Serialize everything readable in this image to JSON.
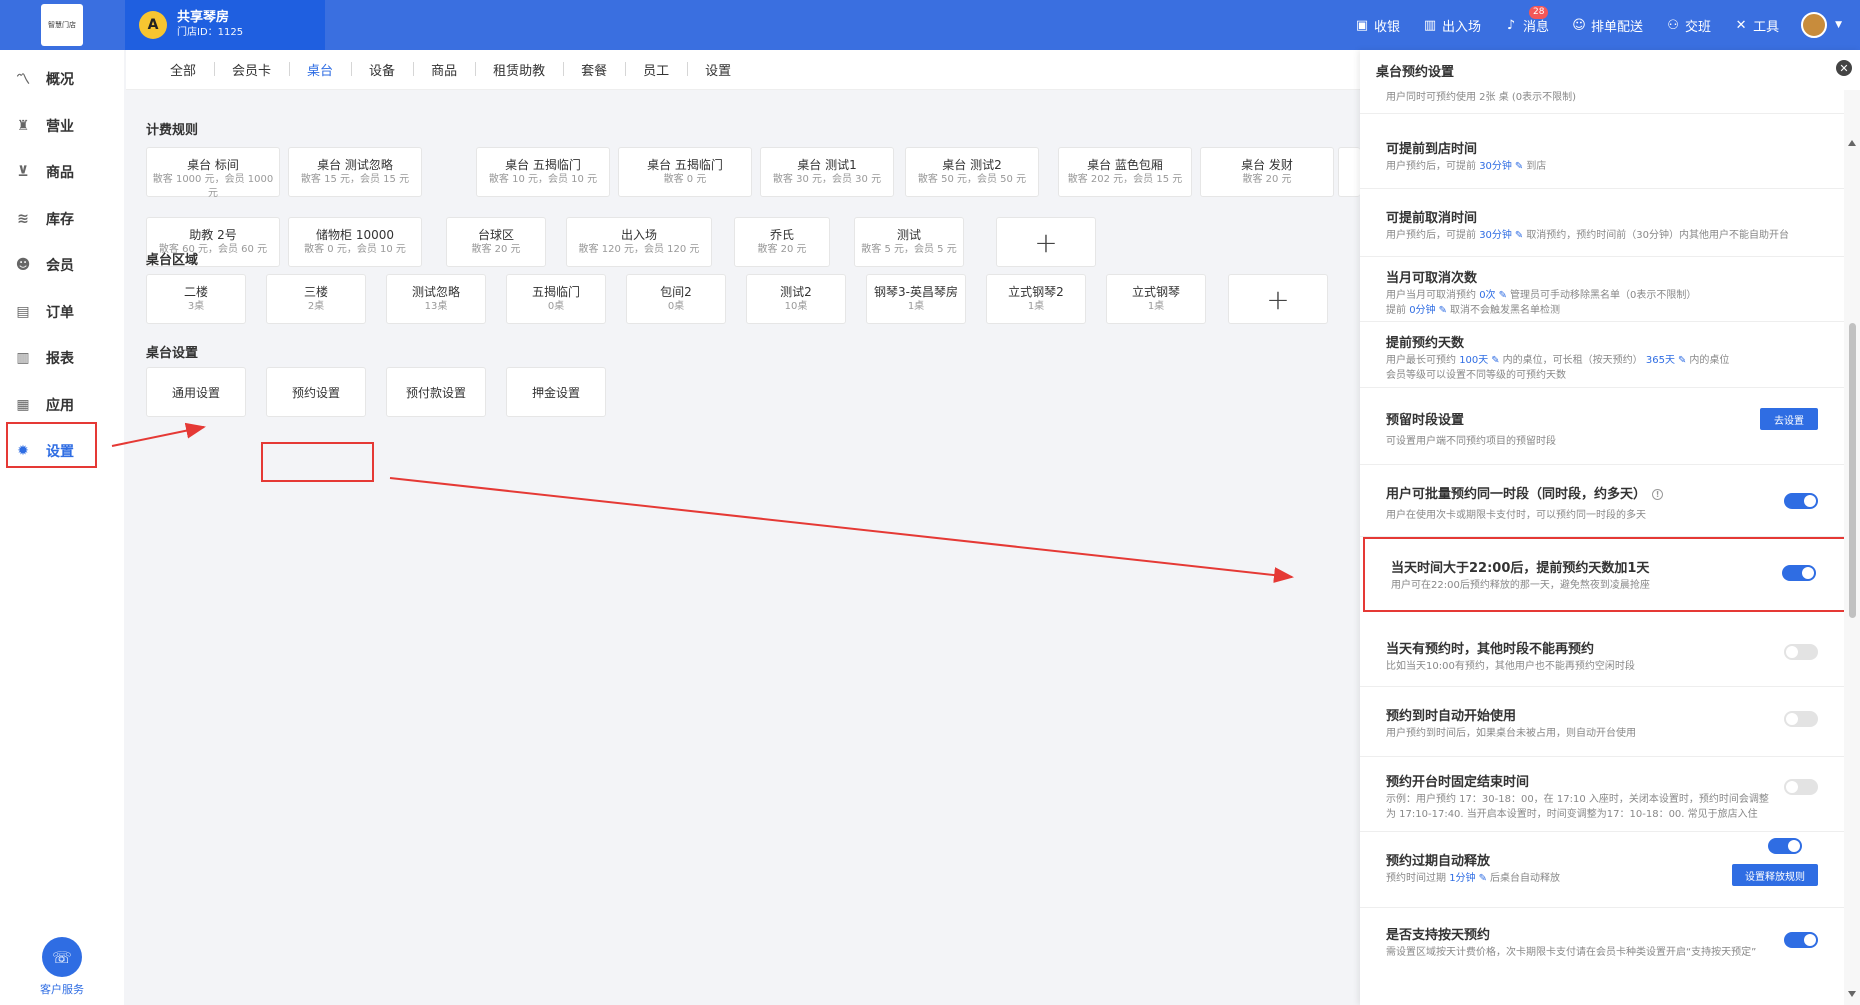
{
  "topbar": {
    "logo_text": "智慧门店",
    "shop_name": "共享琴房",
    "shop_id": "门店ID：1125",
    "actions": [
      {
        "label": "收银",
        "icon": "cash-register-icon"
      },
      {
        "label": "出入场",
        "icon": "door-icon"
      },
      {
        "label": "消息",
        "icon": "bell-icon",
        "badge": "28"
      },
      {
        "label": "排单配送",
        "icon": "users-icon"
      },
      {
        "label": "交班",
        "icon": "handover-icon"
      },
      {
        "label": "工具",
        "icon": "tools-icon"
      }
    ]
  },
  "sidebar": {
    "items": [
      {
        "label": "概况",
        "icon": "chart-line-icon"
      },
      {
        "label": "营业",
        "icon": "money-bag-icon"
      },
      {
        "label": "商品",
        "icon": "cart-icon"
      },
      {
        "label": "库存",
        "icon": "layers-icon"
      },
      {
        "label": "会员",
        "icon": "member-icon"
      },
      {
        "label": "订单",
        "icon": "order-icon"
      },
      {
        "label": "报表",
        "icon": "bar-chart-icon"
      },
      {
        "label": "应用",
        "icon": "apps-icon"
      },
      {
        "label": "设置",
        "icon": "gear-icon",
        "active": true
      }
    ],
    "service_label": "客户服务"
  },
  "tabs": [
    "全部",
    "会员卡",
    "桌台",
    "设备",
    "商品",
    "租赁助教",
    "套餐",
    "员工",
    "设置"
  ],
  "active_tab": "桌台",
  "billing": {
    "title": "计费规则",
    "row1": [
      {
        "name": "桌台 标间",
        "sub": "散客 1000 元，会员 1000 元"
      },
      {
        "name": "桌台 测试忽略",
        "sub": "散客 15 元，会员 15 元"
      },
      {
        "name": "桌台 五揭临门",
        "sub": "散客 10 元，会员 10 元"
      },
      {
        "name": "桌台 五揭临门",
        "sub": "散客 0 元"
      },
      {
        "name": "桌台 测试1",
        "sub": "散客 30 元，会员 30 元"
      },
      {
        "name": "桌台 测试2",
        "sub": "散客 50 元，会员 50 元"
      },
      {
        "name": "桌台 蓝色包厢",
        "sub": "散客 202 元，会员 15 元"
      },
      {
        "name": "桌台 发财",
        "sub": "散客 20 元"
      }
    ],
    "row2": [
      {
        "name": "助教 2号",
        "sub": "散客 60 元，会员 60 元"
      },
      {
        "name": "储物柜 10000",
        "sub": "散客 0 元，会员 10 元"
      },
      {
        "name": "台球区",
        "sub": "散客 20 元"
      },
      {
        "name": "出入场",
        "sub": "散客 120 元，会员 120 元"
      },
      {
        "name": "乔氏",
        "sub": "散客 20 元"
      },
      {
        "name": "测试",
        "sub": "散客 5 元，会员 5 元"
      }
    ]
  },
  "areas": {
    "title": "桌台区域",
    "items": [
      {
        "name": "二楼",
        "sub": "3桌"
      },
      {
        "name": "三楼",
        "sub": "2桌"
      },
      {
        "name": "测试忽略",
        "sub": "13桌"
      },
      {
        "name": "五揭临门",
        "sub": "0桌"
      },
      {
        "name": "包间2",
        "sub": "0桌"
      },
      {
        "name": "测试2",
        "sub": "10桌"
      },
      {
        "name": "钢琴3-英昌琴房",
        "sub": "1桌"
      },
      {
        "name": "立式钢琴2",
        "sub": "1桌"
      },
      {
        "name": "立式钢琴",
        "sub": "1桌"
      }
    ]
  },
  "table_settings": {
    "title": "桌台设置",
    "items": [
      "通用设置",
      "预约设置",
      "预付款设置",
      "押金设置"
    ]
  },
  "panel": {
    "title": "桌台预约设置",
    "cut_text": "用户同时可预约使用 2张 桌 (0表示不限制)",
    "rows": [
      {
        "title": "可提前到店时间",
        "desc_pre": "用户预约后，可提前",
        "value": "30分钟",
        "desc_post": "到店"
      },
      {
        "title": "可提前取消时间",
        "desc_pre": "用户预约后，可提前",
        "value": "30分钟",
        "desc_post": "取消预约，预约时间前（30分钟）内其他用户不能自助开台"
      },
      {
        "title": "当月可取消次数",
        "desc1_pre": "用户当月可取消预约",
        "value1": "0次",
        "desc1_post": "管理员可手动移除黑名单（0表示不限制）",
        "desc2_pre": "提前",
        "value2": "0分钟",
        "desc2_post": "取消不会触发黑名单检测"
      },
      {
        "title": "提前预约天数",
        "desc1_pre": "用户最长可预约",
        "value1": "100天",
        "desc1_mid": "内的桌位，可长租（按天预约）",
        "value2": "365天",
        "desc1_post": "内的桌位",
        "desc2": "会员等级可以设置不同等级的可预约天数"
      },
      {
        "title": "预留时段设置",
        "desc": "可设置用户端不同预约项目的预留时段",
        "button": "去设置"
      },
      {
        "title": "用户可批量预约同一时段（同时段，约多天）",
        "desc": "用户在使用次卡或期限卡支付时，可以预约同一时段的多天",
        "on": true
      },
      {
        "title": "当天时间大于22:00后，提前预约天数加1天",
        "desc": "用户可在22:00后预约释放的那一天，避免熬夜到凌晨抢座",
        "on": true
      },
      {
        "title": "当天有预约时，其他时段不能再预约",
        "desc": "比如当天10:00有预约，其他用户也不能再预约空闲时段",
        "on": false
      },
      {
        "title": "预约到时自动开始使用",
        "desc": "用户预约到时间后，如果桌台未被占用，则自动开台使用",
        "on": false
      },
      {
        "title": "预约开台时固定结束时间",
        "desc1": "示例：用户预约 17：30-18：00，在 17:10 入座时，关闭本设置时，预约时间会调整",
        "desc2": "为 17:10-17:40. 当开启本设置时，时间变调整为17：10-18：00. 常见于旅店入住",
        "on": false
      },
      {
        "title": "预约过期自动释放",
        "desc_pre": "预约时间过期",
        "value": "1分钟",
        "desc_post": "后桌台自动释放",
        "on": true,
        "button": "设置释放规则"
      },
      {
        "title": "是否支持按天预约",
        "desc": "需设置区域按天计费价格，次卡期限卡支付请在会员卡种类设置开启“支持按天预定”",
        "on": true
      }
    ]
  },
  "colors": {
    "primary": "#2f6de3",
    "topbar": "#3a6fe0",
    "highlight": "#e53935"
  }
}
